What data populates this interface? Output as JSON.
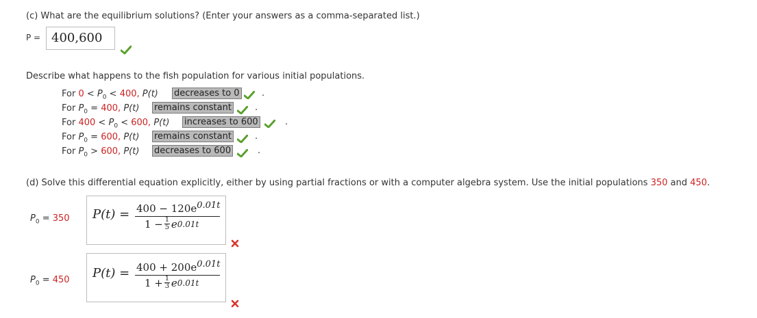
{
  "part_c": {
    "question": "(c) What are the equilibrium solutions? (Enter your answers as a comma-separated list.)",
    "var_label": "P =",
    "answer": "400,600"
  },
  "describe": {
    "question": "Describe what happens to the fish population for various initial populations.",
    "rows": [
      {
        "for": "For",
        "cond1": "0",
        "op1": "<",
        "p0": "P",
        "sub": "0",
        "op2": "<",
        "val2": "400,",
        "pt": "P(t)",
        "answer": "decreases to 0",
        "end": "."
      },
      {
        "for": "For",
        "p0": "P",
        "sub": "0",
        "eq": "=",
        "val": "400,",
        "pt": "P(t)",
        "answer": "remains constant",
        "end": "."
      },
      {
        "for": "For",
        "cond1": "400",
        "op1": "<",
        "p0": "P",
        "sub": "0",
        "op2": "<",
        "val2": "600,",
        "pt": "P(t)",
        "answer": "increases to 600",
        "end": "."
      },
      {
        "for": "For",
        "p0": "P",
        "sub": "0",
        "eq": "=",
        "val": "600,",
        "pt": "P(t)",
        "answer": "remains constant",
        "end": "."
      },
      {
        "for": "For",
        "p0": "P",
        "sub": "0",
        "eq": ">",
        "val": "600,",
        "pt": "P(t)",
        "answer": "decreases to 600",
        "end": "."
      }
    ]
  },
  "part_d": {
    "question_pre": "(d) Solve this differential equation explicitly, either by using partial fractions or with a computer algebra system. Use the initial populations ",
    "pop1": "350",
    "and": " and ",
    "pop2": "450",
    "period": ".",
    "answers": [
      {
        "p_label": "P",
        "p_sub": "0",
        "p_eq": "=",
        "p_val": "350",
        "lhs": "P(t) =",
        "num_a": "400 − 120e",
        "num_exp": "0.01t",
        "den_a": "1 −",
        "den_frac_num": "1",
        "den_frac_den": "5",
        "den_e": "e",
        "den_exp": "0.01t"
      },
      {
        "p_label": "P",
        "p_sub": "0",
        "p_eq": "=",
        "p_val": "450",
        "lhs": "P(t) =",
        "num_a": "400 + 200e",
        "num_exp": "0.01t",
        "den_a": "1 +",
        "den_frac_num": "1",
        "den_frac_den": "3",
        "den_e": "e",
        "den_exp": "0.01t"
      }
    ]
  },
  "colors": {
    "correct": "#5aa02c",
    "incorrect": "#d9342b",
    "highlight": "#cc2222"
  }
}
